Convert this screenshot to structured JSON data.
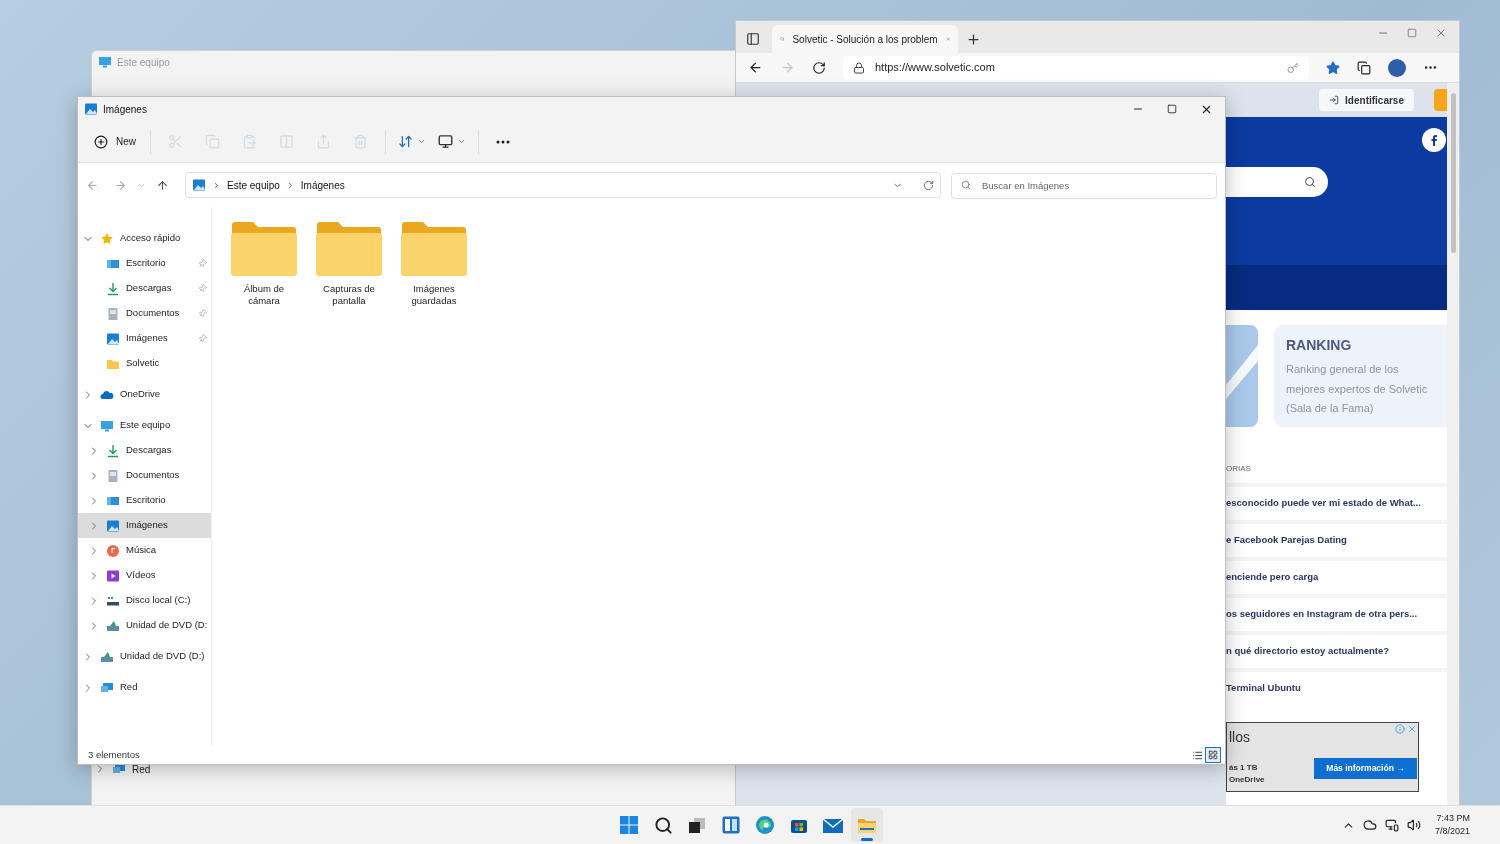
{
  "back_window": {
    "title": "Este equipo",
    "tree_items": [
      {
        "label": "Red",
        "kind": "network",
        "expanded": false
      }
    ]
  },
  "browser": {
    "tabs": [
      {
        "title": "Solvetic - Solución a los problem",
        "selected": true
      }
    ],
    "url": "https://www.solvetic.com",
    "favorite": true,
    "page": {
      "sign_in": "Identificarse",
      "ranking": {
        "title": "RANKING",
        "text": "Ranking general de los mejores expertos de Solvetic (Sala de la Fama)"
      },
      "section_label": "ORIAS",
      "articles": [
        "esconocido puede ver mi estado de What...",
        "e Facebook Parejas Dating",
        "enciende pero carga",
        "os seguidores en Instagram de otra pers...",
        "n qué directorio estoy actualmente?",
        "Terminal Ubuntu"
      ],
      "ad": {
        "title": "llos",
        "lines": [
          "ás 1 TB",
          "OneDrive"
        ],
        "button": "Más información →"
      }
    }
  },
  "explorer": {
    "title": "Imágenes",
    "toolbar": [
      {
        "kind": "new",
        "label": "New"
      },
      {
        "kind": "cut",
        "disabled": true
      },
      {
        "kind": "copy",
        "disabled": true
      },
      {
        "kind": "paste",
        "disabled": true
      },
      {
        "kind": "rename",
        "disabled": true
      },
      {
        "kind": "share",
        "disabled": true
      },
      {
        "kind": "delete",
        "disabled": true
      },
      {
        "kind": "sort"
      },
      {
        "kind": "view"
      },
      {
        "kind": "more"
      }
    ],
    "path": [
      "Este equipo",
      "Imágenes"
    ],
    "search": {
      "placeholder": "Buscar en Imágenes"
    },
    "tree": [
      {
        "label": "Acceso rápido",
        "kind": "star",
        "expanded": true,
        "selected": false,
        "children": [
          {
            "label": "Escritorio",
            "kind": "desktop",
            "pinned": true,
            "selected": false
          },
          {
            "label": "Descargas",
            "kind": "download",
            "pinned": true,
            "selected": false
          },
          {
            "label": "Documentos",
            "kind": "document",
            "pinned": true,
            "selected": false
          },
          {
            "label": "Imágenes",
            "kind": "pictures",
            "pinned": true,
            "selected": false
          },
          {
            "label": "Solvetic",
            "kind": "folder",
            "pinned": false,
            "selected": false
          }
        ]
      },
      {
        "label": "OneDrive",
        "kind": "cloud",
        "expanded": false,
        "selected": false
      },
      {
        "label": "Este equipo",
        "kind": "pc",
        "expanded": true,
        "selected": false,
        "children": [
          {
            "label": "Descargas",
            "kind": "download",
            "expanded": false,
            "selected": false
          },
          {
            "label": "Documentos",
            "kind": "document",
            "expanded": false,
            "selected": false
          },
          {
            "label": "Escritorio",
            "kind": "desktop",
            "expanded": false,
            "selected": false
          },
          {
            "label": "Imágenes",
            "kind": "pictures",
            "expanded": false,
            "selected": true
          },
          {
            "label": "Música",
            "kind": "music",
            "expanded": false,
            "selected": false
          },
          {
            "label": "Vídeos",
            "kind": "video",
            "expanded": false,
            "selected": false
          },
          {
            "label": "Disco local (C:)",
            "kind": "drive",
            "expanded": false,
            "selected": false
          },
          {
            "label": "Unidad de DVD (D:",
            "kind": "dvd",
            "expanded": false,
            "selected": false
          }
        ]
      },
      {
        "label": "Unidad de DVD (D:)",
        "kind": "dvd",
        "expanded": false,
        "selected": false
      },
      {
        "label": "Red",
        "kind": "network",
        "expanded": false,
        "selected": false
      }
    ],
    "folders": [
      {
        "name": "Álbum de cámara"
      },
      {
        "name": "Capturas de pantalla"
      },
      {
        "name": "Imágenes guardadas"
      }
    ],
    "status": "3 elementos",
    "views": [
      {
        "kind": "details",
        "selected": false
      },
      {
        "kind": "tiles",
        "selected": true
      }
    ]
  },
  "taskbar": {
    "apps": [
      {
        "kind": "start",
        "active": false
      },
      {
        "kind": "search",
        "active": false
      },
      {
        "kind": "taskview",
        "active": false
      },
      {
        "kind": "widgets",
        "active": false
      },
      {
        "kind": "edge",
        "active": false
      },
      {
        "kind": "store",
        "active": false
      },
      {
        "kind": "mail",
        "active": false
      },
      {
        "kind": "explorer",
        "active": true
      }
    ],
    "time": "7:43 PM",
    "date": "7/8/2021"
  }
}
